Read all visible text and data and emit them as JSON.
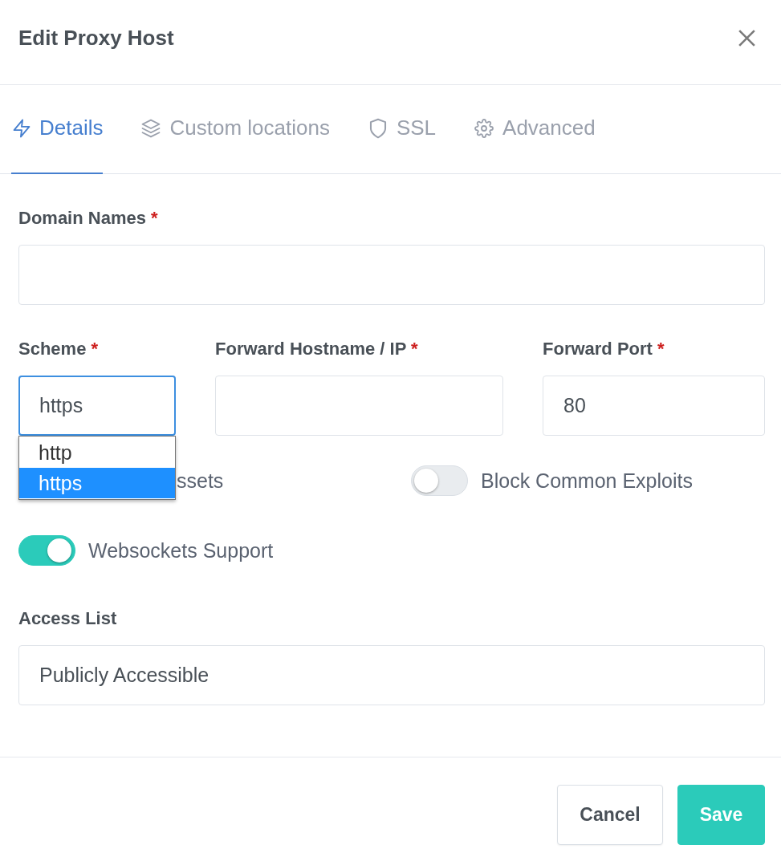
{
  "dialog": {
    "title": "Edit Proxy Host"
  },
  "tabs": [
    {
      "label": "Details",
      "selected": true
    },
    {
      "label": "Custom locations",
      "selected": false
    },
    {
      "label": "SSL",
      "selected": false
    },
    {
      "label": "Advanced",
      "selected": false
    }
  ],
  "domain_names": {
    "label": "Domain Names",
    "required_mark": "*"
  },
  "forward": [
    {
      "kind": "select",
      "label": "Scheme",
      "required_mark": "*",
      "value": "https",
      "focused": true,
      "dropdown": {
        "options": [
          {
            "label": "http",
            "selected": false
          },
          {
            "label": "https",
            "selected": true
          }
        ]
      }
    },
    {
      "kind": "input",
      "label": "Forward Hostname / IP",
      "required_mark": "*",
      "focused": false
    },
    {
      "kind": "input",
      "label": "Forward Port",
      "required_mark": "*",
      "value": "80",
      "focused": false
    }
  ],
  "switches": [
    {
      "kind": "covered",
      "label": "ssets"
    },
    {
      "kind": "switch",
      "label": "Block Common Exploits",
      "on": false
    },
    {
      "kind": "switch",
      "label": "Websockets Support",
      "on": true
    }
  ],
  "access_list": {
    "label": "Access List",
    "value": "Publicly Accessible"
  },
  "buttons": [
    {
      "label": "Cancel",
      "kind": "secondary"
    },
    {
      "label": "Save",
      "kind": "primary"
    }
  ]
}
